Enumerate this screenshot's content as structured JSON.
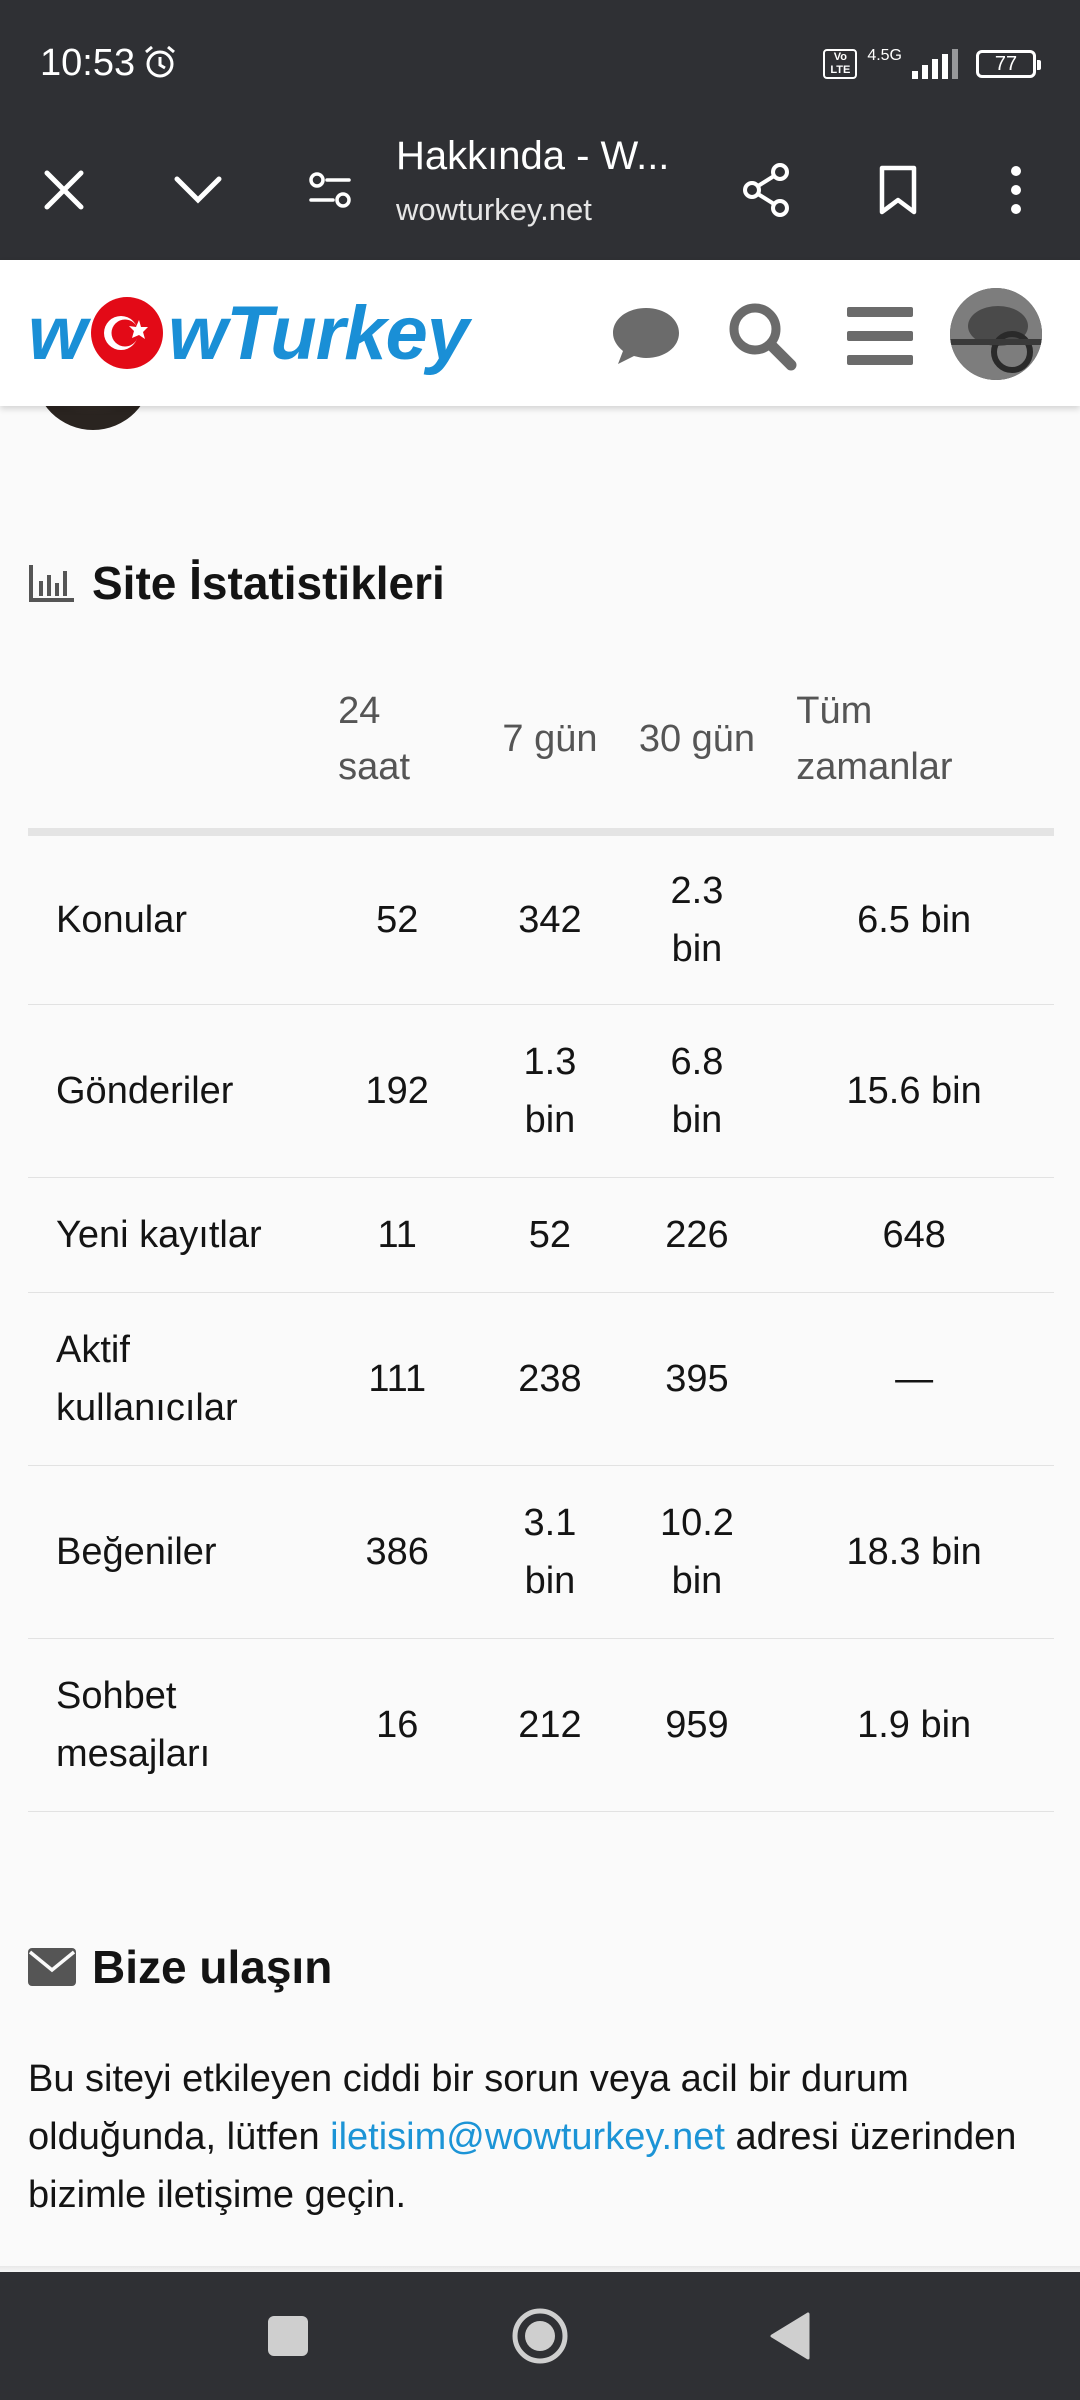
{
  "status_bar": {
    "time": "10:53",
    "network": "4.5G",
    "volte": "Vo LTE",
    "battery": "77"
  },
  "browser": {
    "page_title": "Hakkında - W...",
    "host": "wowturkey.net"
  },
  "site": {
    "logo_text_left": "w",
    "logo_text_right": "wTurkey",
    "brand_color": "#1a8fd6",
    "flag_color": "#e30a17"
  },
  "stats": {
    "heading": "Site İstatistikleri",
    "columns": [
      "24 saat",
      "7 gün",
      "30 gün",
      "Tüm zamanlar"
    ],
    "rows": [
      {
        "label": "Konular",
        "values": [
          "52",
          "342",
          "2.3 bin",
          "6.5 bin"
        ]
      },
      {
        "label": "Gönderiler",
        "values": [
          "192",
          "1.3 bin",
          "6.8 bin",
          "15.6 bin"
        ]
      },
      {
        "label": "Yeni kayıtlar",
        "values": [
          "11",
          "52",
          "226",
          "648"
        ]
      },
      {
        "label": "Aktif kullanıcılar",
        "values": [
          "111",
          "238",
          "395",
          "—"
        ]
      },
      {
        "label": "Beğeniler",
        "values": [
          "386",
          "3.1 bin",
          "10.2 bin",
          "18.3 bin"
        ]
      },
      {
        "label": "Sohbet mesajları",
        "values": [
          "16",
          "212",
          "959",
          "1.9 bin"
        ]
      }
    ]
  },
  "contact": {
    "heading": "Bize ulaşın",
    "text_before": "Bu siteyi etkileyen ciddi bir sorun veya acil bir durum olduğunda, lütfen ",
    "email": "iletisim@wowturkey.net",
    "text_after": " adresi üzerinden bizimle iletişime geçin."
  }
}
